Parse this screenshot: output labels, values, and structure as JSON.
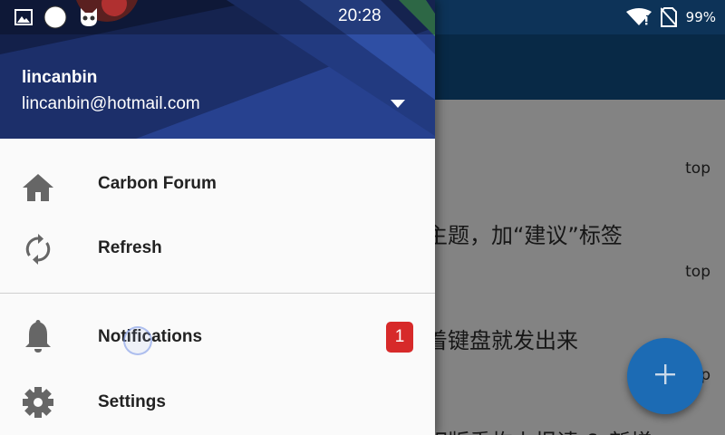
{
  "status_bar": {
    "time": "20:28",
    "battery": "99%",
    "icons": [
      "image-icon",
      "circle-icon",
      "cat-mask-icon",
      "wifi-icon",
      "no-sim-icon"
    ]
  },
  "topics": [
    {
      "meta": "top"
    },
    {
      "title": "主题，加“建议”标签",
      "meta": "top"
    },
    {
      "title": "着键盘就发出来",
      "meta": "op"
    },
    {
      "title": "相版重构上报请 & 新增"
    }
  ],
  "fab": {
    "icon": "add-icon"
  },
  "drawer": {
    "user_name": "lincanbin",
    "user_email": "lincanbin@hotmail.com",
    "menu": [
      {
        "label": "Carbon Forum",
        "icon": "home-icon"
      },
      {
        "label": "Refresh",
        "icon": "refresh-icon"
      },
      {
        "label": "Notifications",
        "icon": "bell-icon",
        "badge": "1"
      },
      {
        "label": "Settings",
        "icon": "gear-icon"
      }
    ]
  },
  "colors": {
    "primary": "#0f4b80",
    "header": "#13204a",
    "accent_fab": "#1c6bb4",
    "badge": "#d72a2a"
  }
}
